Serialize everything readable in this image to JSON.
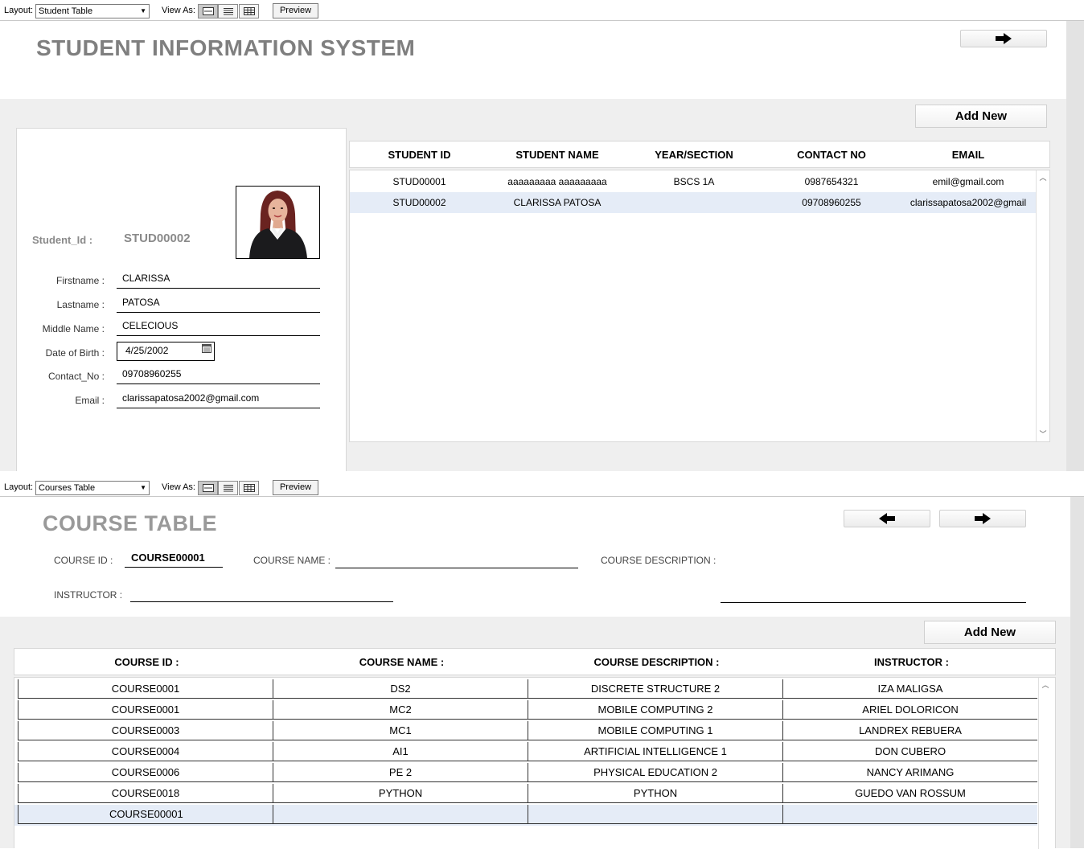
{
  "top_toolbar": {
    "layout_label": "Layout:",
    "layout_value": "Student Table",
    "view_as_label": "View As:",
    "preview_label": "Preview"
  },
  "student_section": {
    "title": "STUDENT INFORMATION SYSTEM",
    "add_new_label": "Add New",
    "form": {
      "student_id_label": "Student_Id  :",
      "student_id_value": "STUD00002",
      "firstname_label": "Firstname :",
      "firstname_value": "CLARISSA",
      "lastname_label": "Lastname :",
      "lastname_value": "PATOSA",
      "middlename_label": "Middle Name :",
      "middlename_value": "CELECIOUS",
      "dob_label": "Date of Birth :",
      "dob_value": "4/25/2002",
      "contact_label": "Contact_No :",
      "contact_value": "09708960255",
      "email_label": "Email :",
      "email_value": "clarissapatosa2002@gmail.com"
    },
    "table": {
      "headers": [
        "STUDENT ID",
        "STUDENT NAME",
        "YEAR/SECTION",
        "CONTACT NO",
        "EMAIL"
      ],
      "rows": [
        [
          "STUD00001",
          "aaaaaaaaa aaaaaaaaa",
          "BSCS 1A",
          "0987654321",
          "emil@gmail.com"
        ],
        [
          "STUD00002",
          "CLARISSA PATOSA",
          "",
          "09708960255",
          "clarissapatosa2002@gmail"
        ]
      ],
      "selected_row": 1
    }
  },
  "bottom_toolbar": {
    "layout_label": "Layout:",
    "layout_value": "Courses Table",
    "view_as_label": "View As:",
    "preview_label": "Preview"
  },
  "course_section": {
    "title": "COURSE TABLE",
    "course_id_label": "COURSE ID :",
    "course_id_value": "COURSE00001",
    "course_name_label": "COURSE NAME :",
    "course_name_value": "",
    "course_description_label": "COURSE DESCRIPTION :",
    "course_description_value": "",
    "instructor_label": "INSTRUCTOR :",
    "instructor_value": "",
    "add_new_label": "Add New",
    "table": {
      "headers": [
        "COURSE ID :",
        "COURSE NAME :",
        "COURSE DESCRIPTION :",
        "INSTRUCTOR :"
      ],
      "rows": [
        [
          "COURSE0001",
          "DS2",
          "DISCRETE STRUCTURE 2",
          "IZA MALIGSA"
        ],
        [
          "COURSE0001",
          "MC2",
          "MOBILE COMPUTING 2",
          "ARIEL DOLORICON"
        ],
        [
          "COURSE0003",
          "MC1",
          "MOBILE COMPUTING 1",
          "LANDREX REBUERA"
        ],
        [
          "COURSE0004",
          "AI1",
          "ARTIFICIAL INTELLIGENCE 1",
          "DON CUBERO"
        ],
        [
          "COURSE0006",
          "PE 2",
          "PHYSICAL EDUCATION 2",
          "NANCY ARIMANG"
        ],
        [
          "COURSE0018",
          "PYTHON",
          "PYTHON",
          "GUEDO VAN ROSSUM"
        ],
        [
          "COURSE00001",
          "",
          "",
          ""
        ]
      ],
      "selected_row": 6
    }
  },
  "icons": {
    "next": "arrow-right-icon",
    "prev": "arrow-left-icon",
    "calendar": "calendar-icon"
  }
}
